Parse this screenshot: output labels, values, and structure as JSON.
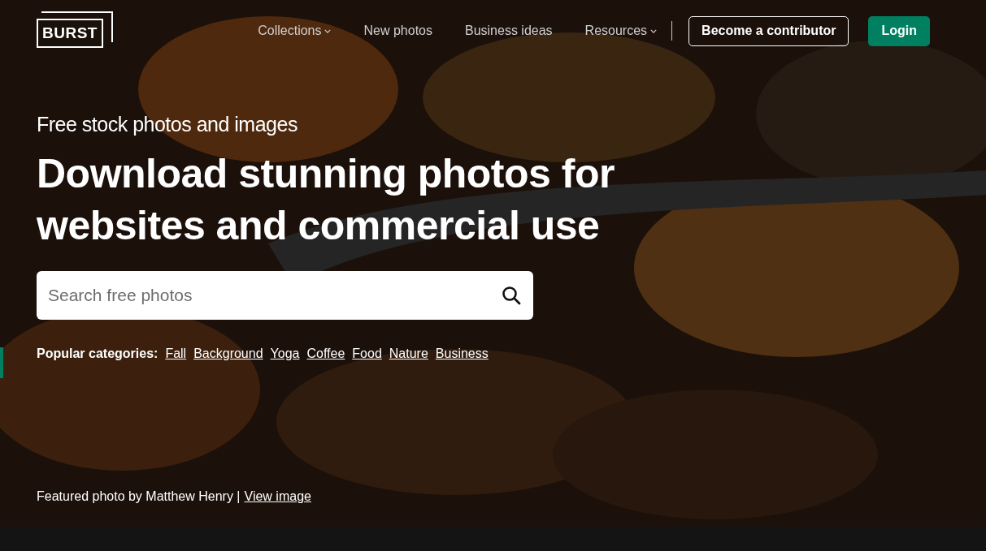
{
  "logo": {
    "text": "BURST"
  },
  "nav": [
    {
      "label": "Collections",
      "kind": "dropdown"
    },
    {
      "label": "New photos",
      "kind": "link"
    },
    {
      "label": "Business ideas",
      "kind": "link"
    },
    {
      "label": "Resources",
      "kind": "dropdown"
    }
  ],
  "buttons": [
    {
      "label": "Become a contributor",
      "kind": "outline"
    },
    {
      "label": "Login",
      "kind": "primary"
    }
  ],
  "hero": {
    "subtitle": "Free stock photos and images",
    "title": "Download stunning photos for websites and commercial use"
  },
  "search": {
    "placeholder": "Search free photos"
  },
  "popular": {
    "label": "Popular categories:",
    "links": [
      "Fall",
      "Background",
      "Yoga",
      "Coffee",
      "Food",
      "Nature",
      "Business"
    ]
  },
  "credit": {
    "text": "Featured photo by Matthew Henry |",
    "link": "View image"
  }
}
